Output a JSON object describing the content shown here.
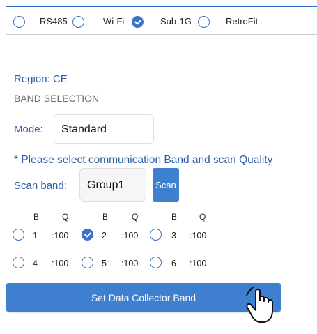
{
  "comm_options": [
    {
      "label": "RS485",
      "selected": false
    },
    {
      "label": "Wi-Fi",
      "selected": false
    },
    {
      "label": "Sub-1G",
      "selected": true
    },
    {
      "label": "RetroFit",
      "selected": false
    }
  ],
  "region": {
    "label": "Region:",
    "value": "CE"
  },
  "band_section_title": "BAND SELECTION",
  "mode": {
    "label": "Mode:",
    "value": "Standard"
  },
  "instruction": "* Please select communication Band and scan Quality",
  "scan": {
    "label": "Scan band:",
    "value": "Group1",
    "button": "Scan"
  },
  "grid_headers": {
    "band": "B",
    "quality": "Q"
  },
  "bands": [
    {
      "band": "1",
      "quality": ":100",
      "selected": false
    },
    {
      "band": "2",
      "quality": ":100",
      "selected": true
    },
    {
      "band": "3",
      "quality": ":100",
      "selected": false
    },
    {
      "band": "4",
      "quality": ":100",
      "selected": false
    },
    {
      "band": "5",
      "quality": ":100",
      "selected": false
    },
    {
      "band": "6",
      "quality": ":100",
      "selected": false
    }
  ],
  "set_button": "Set Data Collector Band",
  "colors": {
    "accent": "#3f7fd0",
    "label_blue": "#2a5fa8"
  }
}
